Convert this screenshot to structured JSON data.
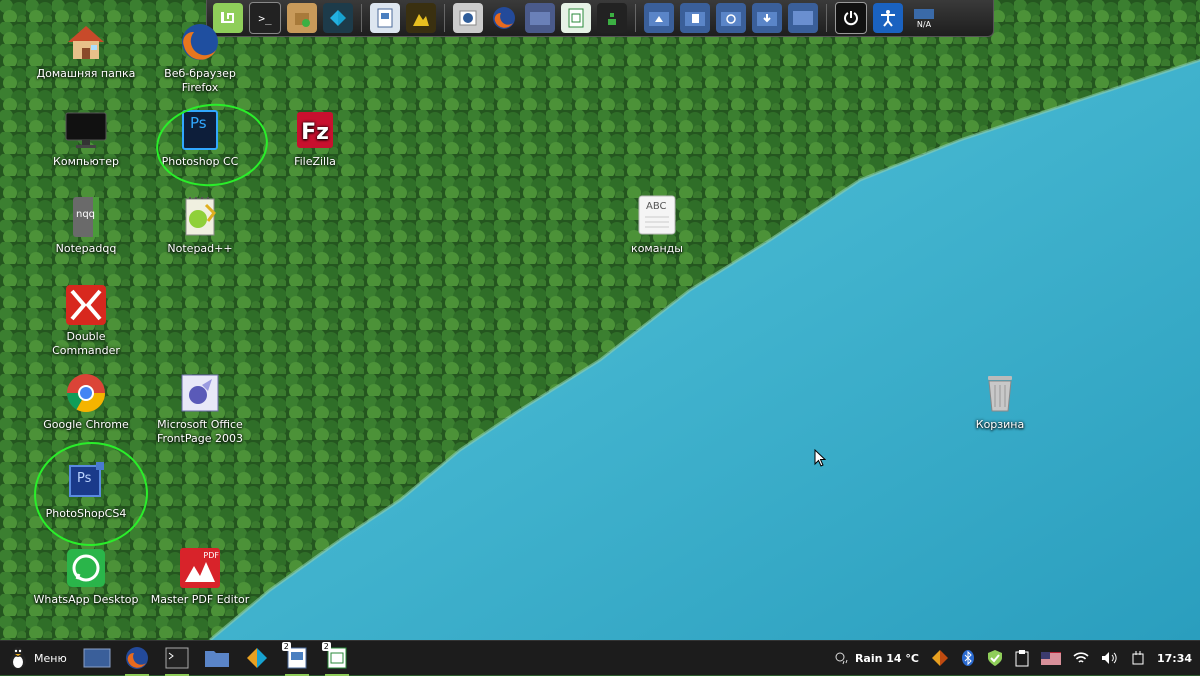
{
  "desktop": {
    "icons": [
      {
        "id": "home",
        "label": "Домашняя папка"
      },
      {
        "id": "firefox",
        "label": "Веб-браузер Firefox"
      },
      {
        "id": "computer",
        "label": "Компьютер"
      },
      {
        "id": "photoshop-cc",
        "label": "Photoshop CC"
      },
      {
        "id": "filezilla",
        "label": "FileZilla"
      },
      {
        "id": "notepadqq",
        "label": "Notepadqq"
      },
      {
        "id": "notepadpp",
        "label": "Notepad++"
      },
      {
        "id": "commands",
        "label": "команды"
      },
      {
        "id": "double-commander",
        "label": "Double Commander"
      },
      {
        "id": "chrome",
        "label": "Google Chrome"
      },
      {
        "id": "frontpage",
        "label": "Microsoft Office FrontPage 2003"
      },
      {
        "id": "trash",
        "label": "Корзина"
      },
      {
        "id": "photoshop-cs4",
        "label": "PhotoShopCS4"
      },
      {
        "id": "whatsapp",
        "label": "WhatsApp Desktop"
      },
      {
        "id": "master-pdf",
        "label": "Master PDF Editor"
      }
    ],
    "commands_icon_text": "ABC",
    "pdf_badge": "PDF",
    "ps_text": "Ps",
    "nqq_text": "nqq"
  },
  "dock": {
    "na_label": "N/A"
  },
  "taskbar": {
    "menu_label": "Меню",
    "badge_1": "2",
    "badge_2": "2",
    "weather": "Rain 14 °C",
    "clock": "17:34"
  },
  "colors": {
    "highlight_circle": "#2aee2a",
    "taskbar_bg": "#1c1c1c",
    "water": "#3ab0cc",
    "forest": "#2d6b2a"
  }
}
